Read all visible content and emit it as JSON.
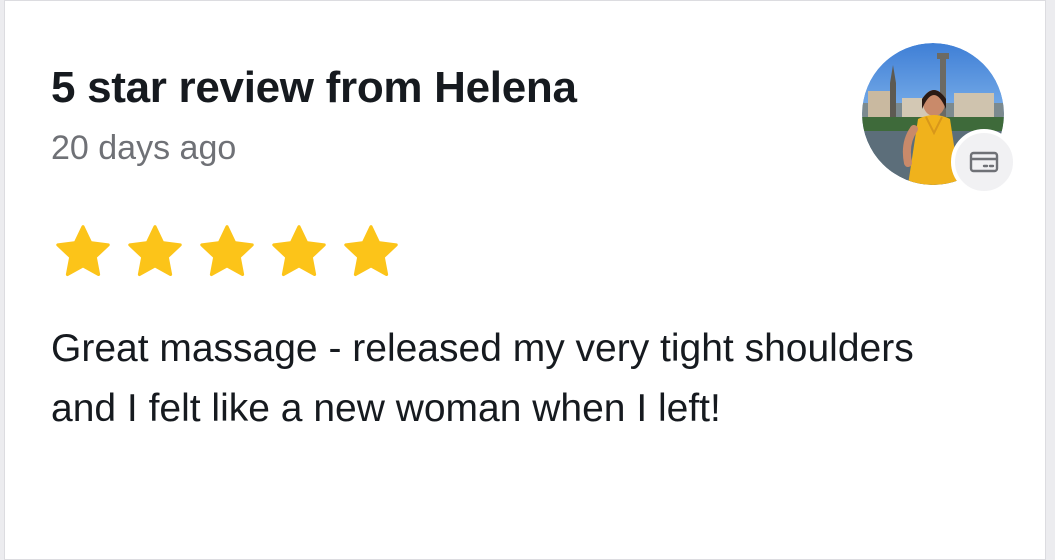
{
  "review": {
    "title": "5 star review from Helena",
    "timestamp": "20 days ago",
    "rating": 5,
    "rating_max": 5,
    "text": "Great massage - released my very tight shoulders and I felt like a new woman when I left!"
  },
  "reviewer": {
    "avatar_icon": "reviewer-avatar-photo",
    "badge_icon": "payment-card-icon"
  },
  "colors": {
    "star": "#fcc419",
    "title": "#161a1f",
    "muted": "#6f7176",
    "badge_bg": "#f1f1f3"
  }
}
